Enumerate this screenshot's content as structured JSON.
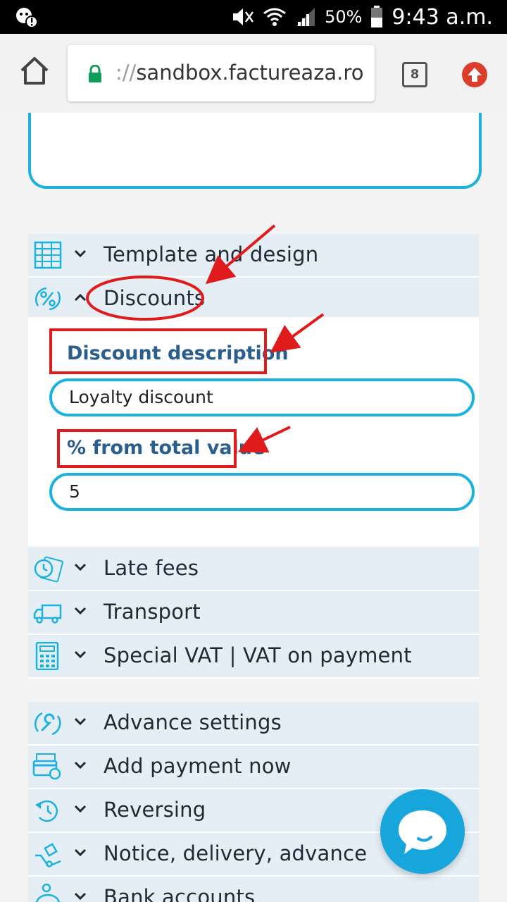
{
  "status_bar": {
    "battery": "50%",
    "time": "9:43 a.m."
  },
  "browser": {
    "url_scheme": "://",
    "url_host": "sandbox.factureaza.ro",
    "tab_count": "8"
  },
  "sections_top": [
    {
      "label": "Template and design",
      "icon": "table-icon",
      "expanded": false
    },
    {
      "label": "Discounts",
      "icon": "percent-icon",
      "expanded": true
    }
  ],
  "discounts_panel": {
    "description_label": "Discount description",
    "description_value": "Loyalty discount",
    "percent_label": "% from total value",
    "percent_value": "5"
  },
  "sections_middle": [
    {
      "label": "Late fees",
      "icon": "clock-money-icon"
    },
    {
      "label": "Transport",
      "icon": "truck-icon"
    },
    {
      "label": "Special VAT | VAT on payment",
      "icon": "calculator-icon"
    }
  ],
  "sections_bottom": [
    {
      "label": "Advance settings",
      "icon": "wrench-icon"
    },
    {
      "label": "Add payment now",
      "icon": "payment-card-icon"
    },
    {
      "label": "Reversing",
      "icon": "reverse-arrow-icon"
    },
    {
      "label": "Notice, delivery, advance",
      "icon": "hand-truck-icon"
    },
    {
      "label": "Bank accounts",
      "icon": "piggy-bank-icon"
    }
  ],
  "colors": {
    "accent": "#1bb2df",
    "label_blue": "#2a5e8e",
    "annotation_red": "#e01b1b",
    "section_bg": "#e4eef4"
  }
}
